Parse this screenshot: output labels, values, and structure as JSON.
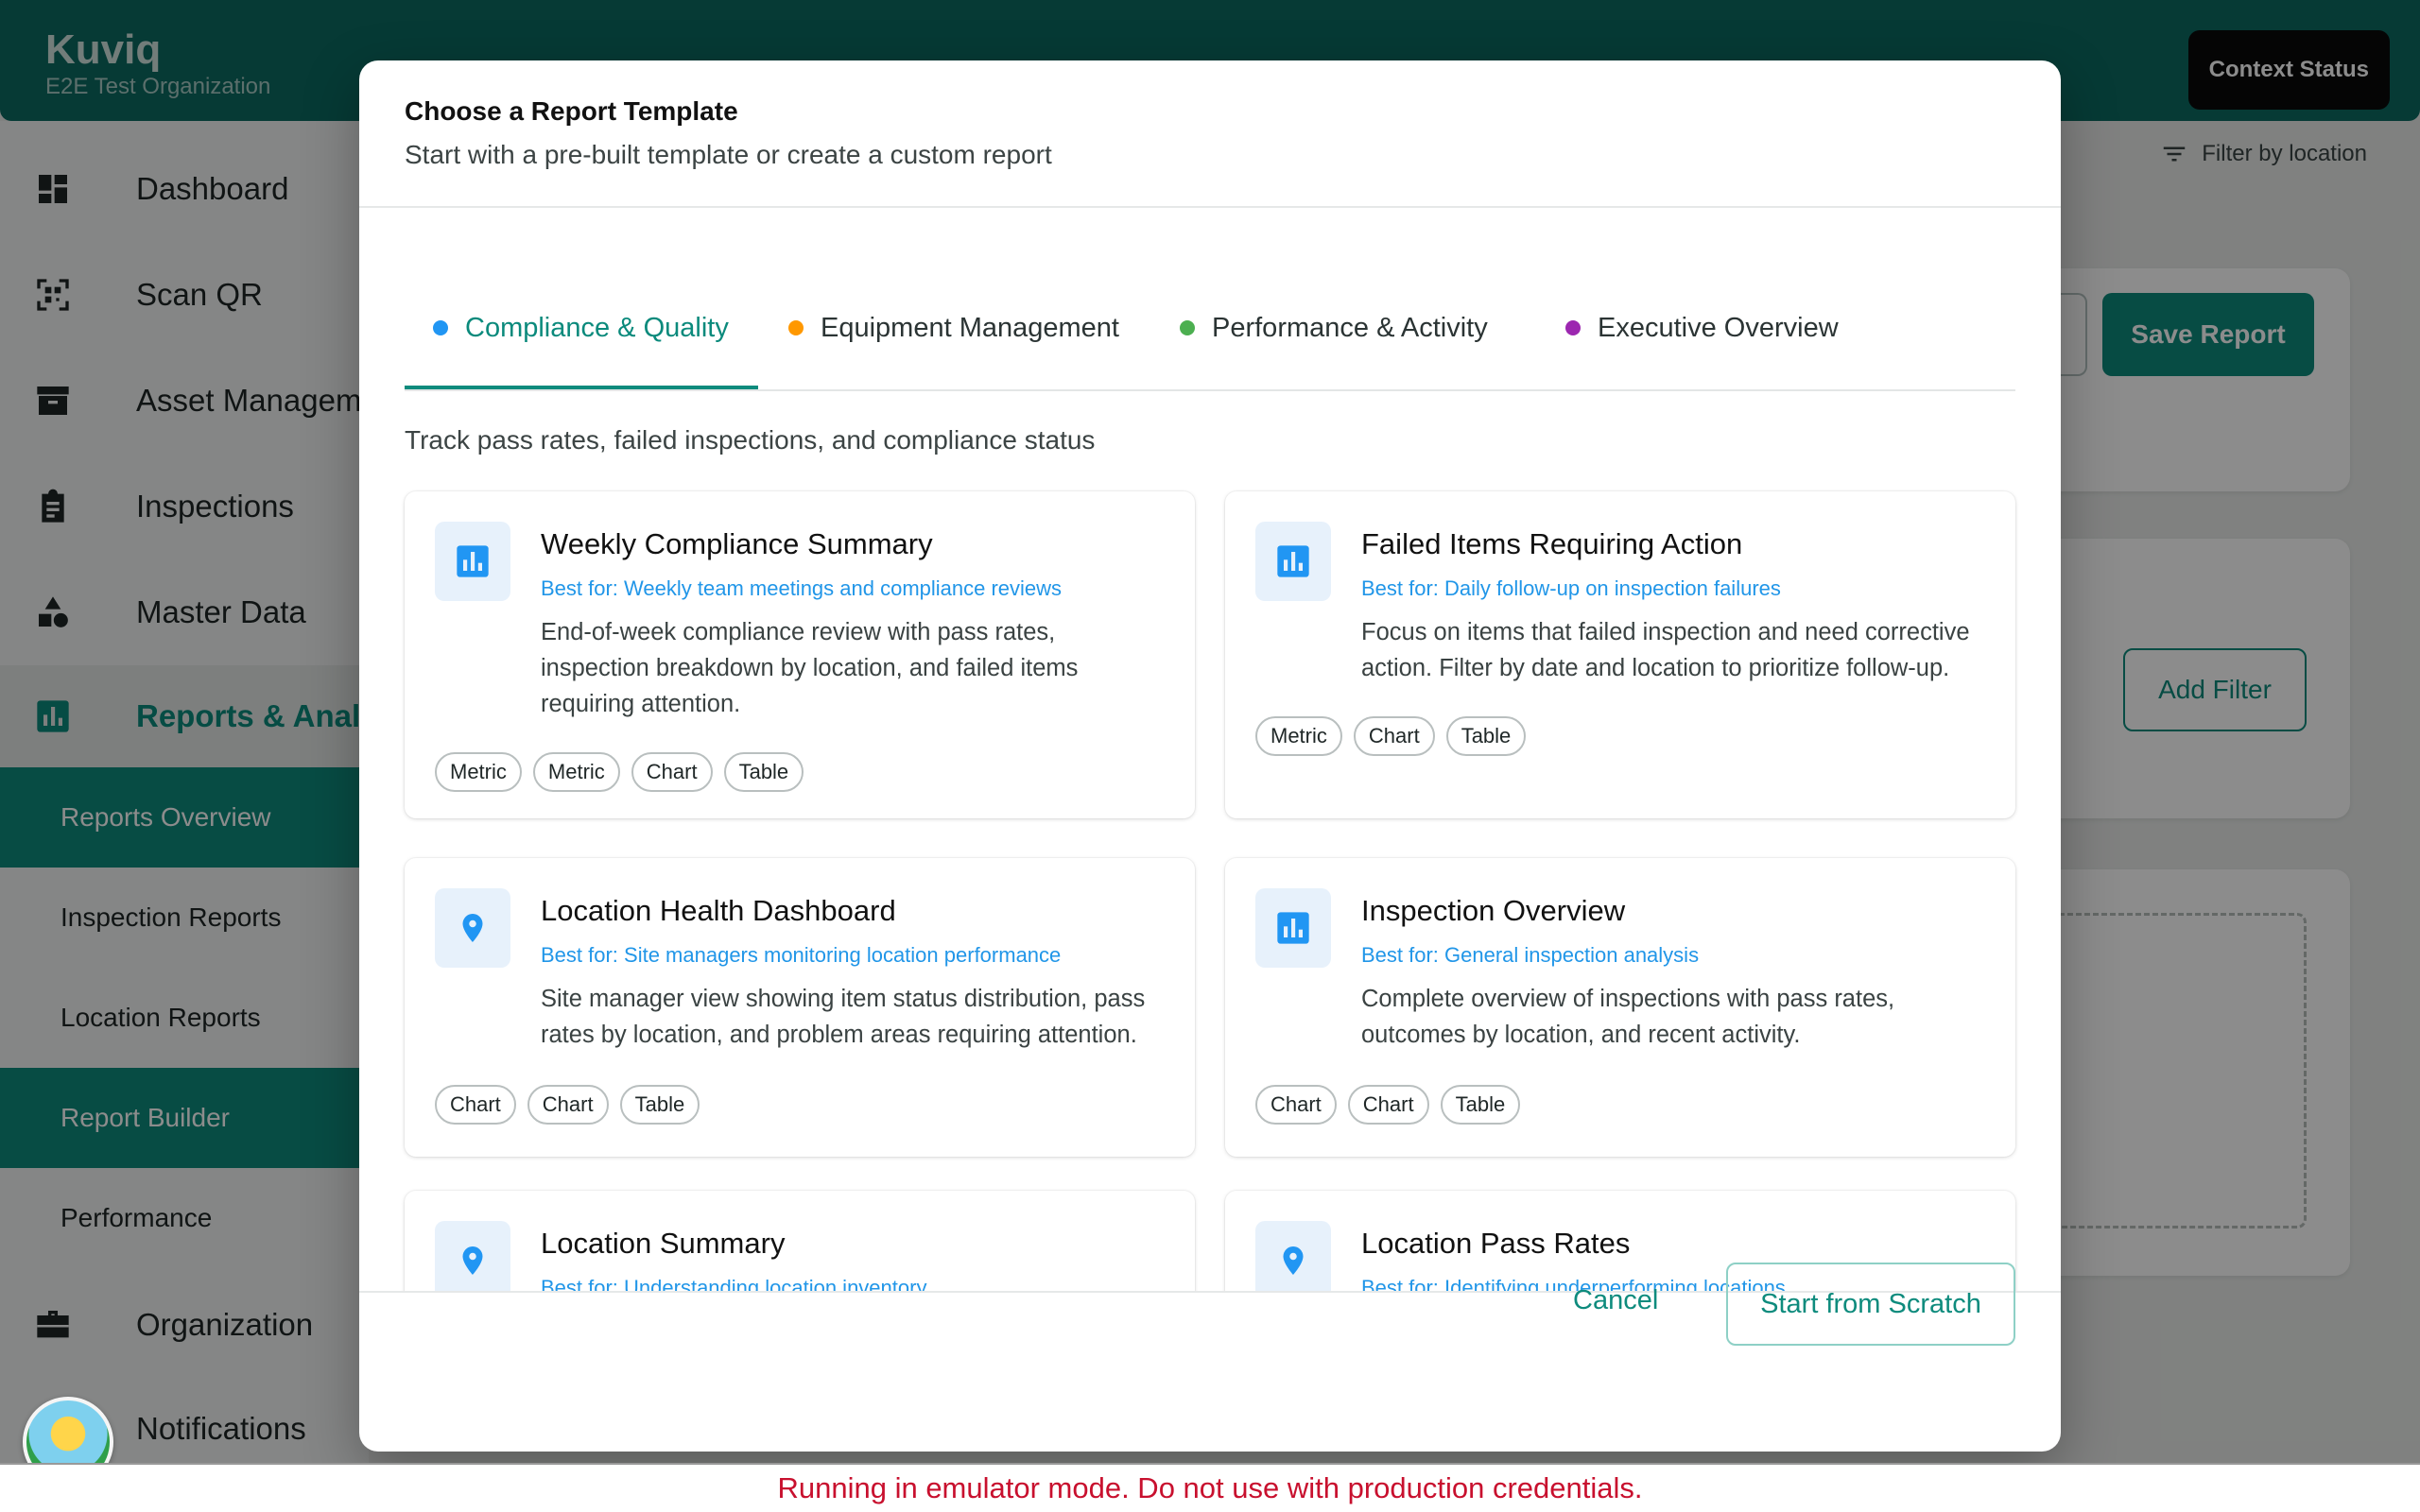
{
  "app": {
    "brand": "Kuviq",
    "organization": "E2E Test Organization",
    "context_status": "Context Status",
    "filter_by_location": "Filter by location"
  },
  "sidebar": {
    "items": [
      {
        "label": "Dashboard",
        "icon": "dashboard-icon"
      },
      {
        "label": "Scan QR",
        "icon": "qr-icon"
      },
      {
        "label": "Asset Management",
        "icon": "archive-icon"
      },
      {
        "label": "Inspections",
        "icon": "clipboard-icon"
      },
      {
        "label": "Master Data",
        "icon": "shapes-icon"
      },
      {
        "label": "Reports & Analytics",
        "icon": "bar-chart-icon"
      },
      {
        "label": "Organization",
        "icon": "briefcase-icon"
      },
      {
        "label": "Notifications",
        "icon": "bell-icon"
      }
    ],
    "reports_sub_items": [
      {
        "label": "Reports Overview"
      },
      {
        "label": "Inspection Reports"
      },
      {
        "label": "Location Reports"
      },
      {
        "label": "Report Builder"
      },
      {
        "label": "Performance"
      }
    ]
  },
  "background": {
    "save_report": "Save Report",
    "add_filter": "Add Filter"
  },
  "modal": {
    "title": "Choose a Report Template",
    "subtitle": "Start with a pre-built template or create a custom report",
    "tabs": [
      {
        "label": "Compliance & Quality",
        "dot_color": "#2196f3"
      },
      {
        "label": "Equipment Management",
        "dot_color": "#ff9800"
      },
      {
        "label": "Performance & Activity",
        "dot_color": "#4caf50"
      },
      {
        "label": "Executive Overview",
        "dot_color": "#9c27b0"
      }
    ],
    "active_tab_description": "Track pass rates, failed inspections, and compliance status",
    "templates": [
      {
        "name": "Weekly Compliance Summary",
        "best_for": "Best for: Weekly team meetings and compliance reviews",
        "description": "End-of-week compliance review with pass rates, inspection breakdown by location, and failed items requiring attention.",
        "icon": "bar-chart-icon",
        "widgets": [
          "Metric",
          "Metric",
          "Chart",
          "Table"
        ]
      },
      {
        "name": "Failed Items Requiring Action",
        "best_for": "Best for: Daily follow-up on inspection failures",
        "description": "Focus on items that failed inspection and need corrective action. Filter by date and location to prioritize follow-up.",
        "icon": "bar-chart-icon",
        "widgets": [
          "Metric",
          "Chart",
          "Table"
        ]
      },
      {
        "name": "Location Health Dashboard",
        "best_for": "Best for: Site managers monitoring location performance",
        "description": "Site manager view showing item status distribution, pass rates by location, and problem areas requiring attention.",
        "icon": "location-pin-icon",
        "widgets": [
          "Chart",
          "Chart",
          "Table"
        ]
      },
      {
        "name": "Inspection Overview",
        "best_for": "Best for: General inspection analysis",
        "description": "Complete overview of inspections with pass rates, outcomes by location, and recent activity.",
        "icon": "bar-chart-icon",
        "widgets": [
          "Chart",
          "Chart",
          "Table"
        ]
      },
      {
        "name": "Location Summary",
        "best_for": "Best for: Understanding location inventory",
        "description": "",
        "icon": "location-pin-icon",
        "widgets": []
      },
      {
        "name": "Location Pass Rates",
        "best_for": "Best for: Identifying underperforming locations",
        "description": "",
        "icon": "location-pin-icon",
        "widgets": []
      }
    ],
    "cancel": "Cancel",
    "start_from_scratch": "Start from Scratch"
  },
  "emulator_banner": "Running in emulator mode. Do not use with production credentials.",
  "colors": {
    "brand": "#0b6b62",
    "accent": "#0e8b7d",
    "link_blue": "#2196e8",
    "warning_red": "#c8102e"
  }
}
